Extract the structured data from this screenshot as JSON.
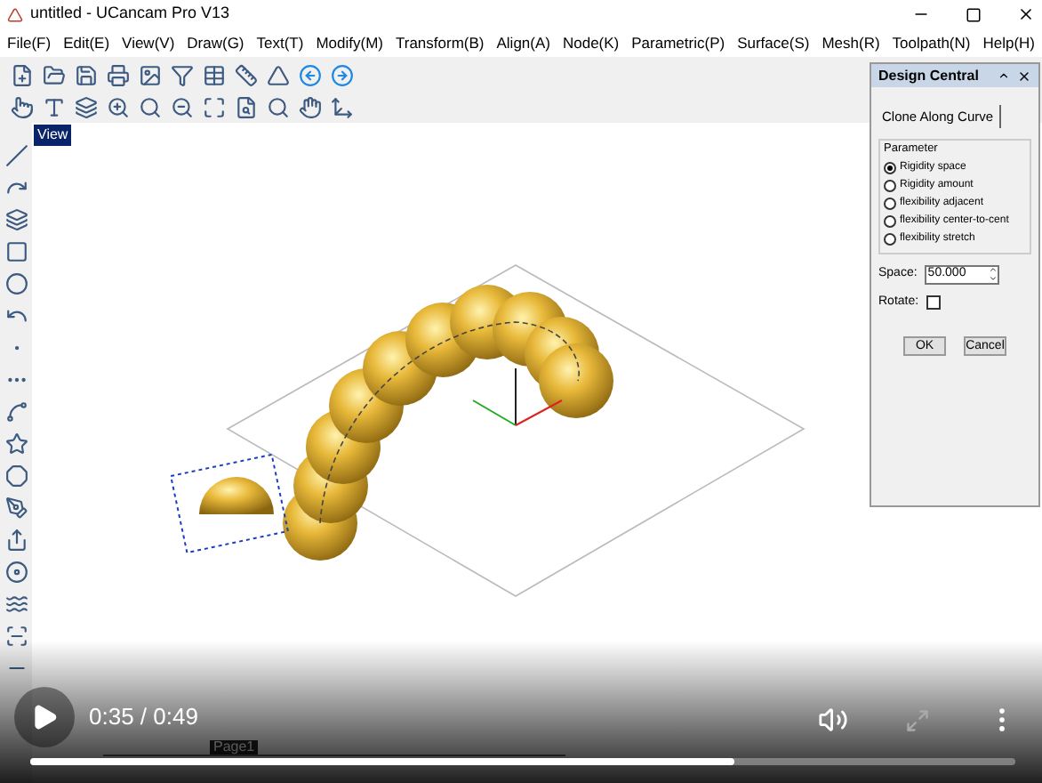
{
  "window": {
    "title": "untitled - UCancam Pro V13"
  },
  "menu": [
    "File(F)",
    "Edit(E)",
    "View(V)",
    "Draw(G)",
    "Text(T)",
    "Modify(M)",
    "Transform(B)",
    "Align(A)",
    "Node(K)",
    "Parametric(P)",
    "Surface(S)",
    "Mesh(R)",
    "Toolpath(N)",
    "Help(H)"
  ],
  "view": {
    "label": "View"
  },
  "design_central": {
    "title": "Design Central",
    "tab": "Clone Along Curve",
    "group": "Parameter",
    "options": [
      {
        "label": "Rigidity space",
        "selected": true
      },
      {
        "label": "Rigidity amount",
        "selected": false
      },
      {
        "label": "flexibility adjacent",
        "selected": false
      },
      {
        "label": "flexibility center-to-cent",
        "selected": false
      },
      {
        "label": "flexibility stretch",
        "selected": false
      }
    ],
    "space_label": "Space:",
    "space_value": "50.000",
    "rotate_label": "Rotate:",
    "rotate_checked": false,
    "buttons": [
      "OK",
      "Cancel"
    ]
  },
  "page_tab": "Page1",
  "video": {
    "time": "0:35 / 0:49",
    "level": 0.714
  }
}
